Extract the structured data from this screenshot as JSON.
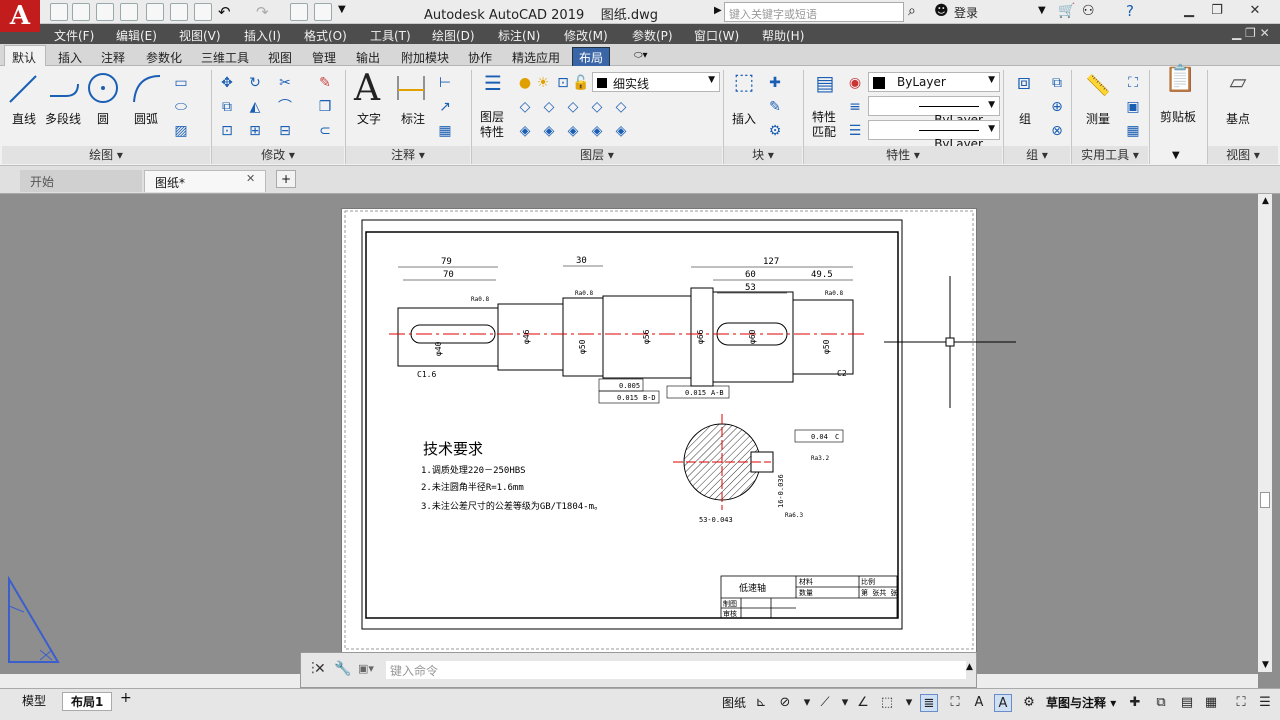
{
  "app": {
    "title": "Autodesk AutoCAD 2019",
    "file": "图纸.dwg",
    "logo": "A",
    "login": "登录"
  },
  "search": {
    "placeholder": "键入关键字或短语"
  },
  "menus": [
    "文件(F)",
    "编辑(E)",
    "视图(V)",
    "插入(I)",
    "格式(O)",
    "工具(T)",
    "绘图(D)",
    "标注(N)",
    "修改(M)",
    "参数(P)",
    "窗口(W)",
    "帮助(H)"
  ],
  "ribbon_tabs": [
    "默认",
    "插入",
    "注释",
    "参数化",
    "三维工具",
    "视图",
    "管理",
    "输出",
    "附加模块",
    "协作",
    "精选应用",
    "布局"
  ],
  "panels": {
    "draw": {
      "title": "绘图",
      "line": "直线",
      "polyline": "多段线",
      "circle": "圆",
      "arc": "圆弧"
    },
    "modify": {
      "title": "修改"
    },
    "annotation": {
      "title": "注释",
      "text": "文字",
      "dimension": "标注"
    },
    "layers": {
      "title": "图层",
      "props": "图层\n特性",
      "current_layer": "细实线"
    },
    "block": {
      "title": "块",
      "insert": "插入"
    },
    "properties": {
      "title": "特性",
      "match": "特性\n匹配",
      "color": "ByLayer",
      "linetype": "ByLayer",
      "lineweight": "ByLayer"
    },
    "groups": {
      "title": "组",
      "group": "组"
    },
    "utilities": {
      "title": "实用工具",
      "measure": "测量"
    },
    "clipboard": {
      "title": "剪贴板"
    },
    "view": {
      "title": "视图",
      "base": "基点"
    }
  },
  "doc_tabs": [
    "开始",
    "图纸*"
  ],
  "drawing": {
    "dims_top": [
      "79",
      "70",
      "30",
      "127",
      "60",
      "49.5",
      "53"
    ],
    "diameters": [
      "φ40",
      "φ46",
      "φ50",
      "φ56",
      "φ60",
      "φ66",
      "φ50"
    ],
    "chamfers": [
      "C1.6",
      "C2"
    ],
    "tolerances": [
      "0.005",
      "0.015",
      "B-D",
      "0.015",
      "A-B",
      "0.04",
      "C"
    ],
    "roughness": [
      "Ra0.8",
      "Ra0.8",
      "Ra0.8",
      "Ra3.2",
      "Ra6.3"
    ],
    "section_dims": [
      "53-0.043",
      "16-0.036"
    ],
    "tech_title": "技术要求",
    "tech_notes": [
      "1.调质处理220－250HBS",
      "2.未注圆角半径R=1.6mm",
      "3.未注公差尺寸的公差等级为GB/T1804-m。"
    ],
    "title_block": {
      "name": "低速轴",
      "material": "材料",
      "quantity": "数量",
      "scale": "比例",
      "drawn": "制图",
      "checked": "审核",
      "sheet": "第 张共 张"
    }
  },
  "command": {
    "placeholder": "键入命令"
  },
  "layout_tabs": [
    "模型",
    "布局1"
  ],
  "status": {
    "paper": "图纸",
    "workspace": "草图与注释"
  }
}
